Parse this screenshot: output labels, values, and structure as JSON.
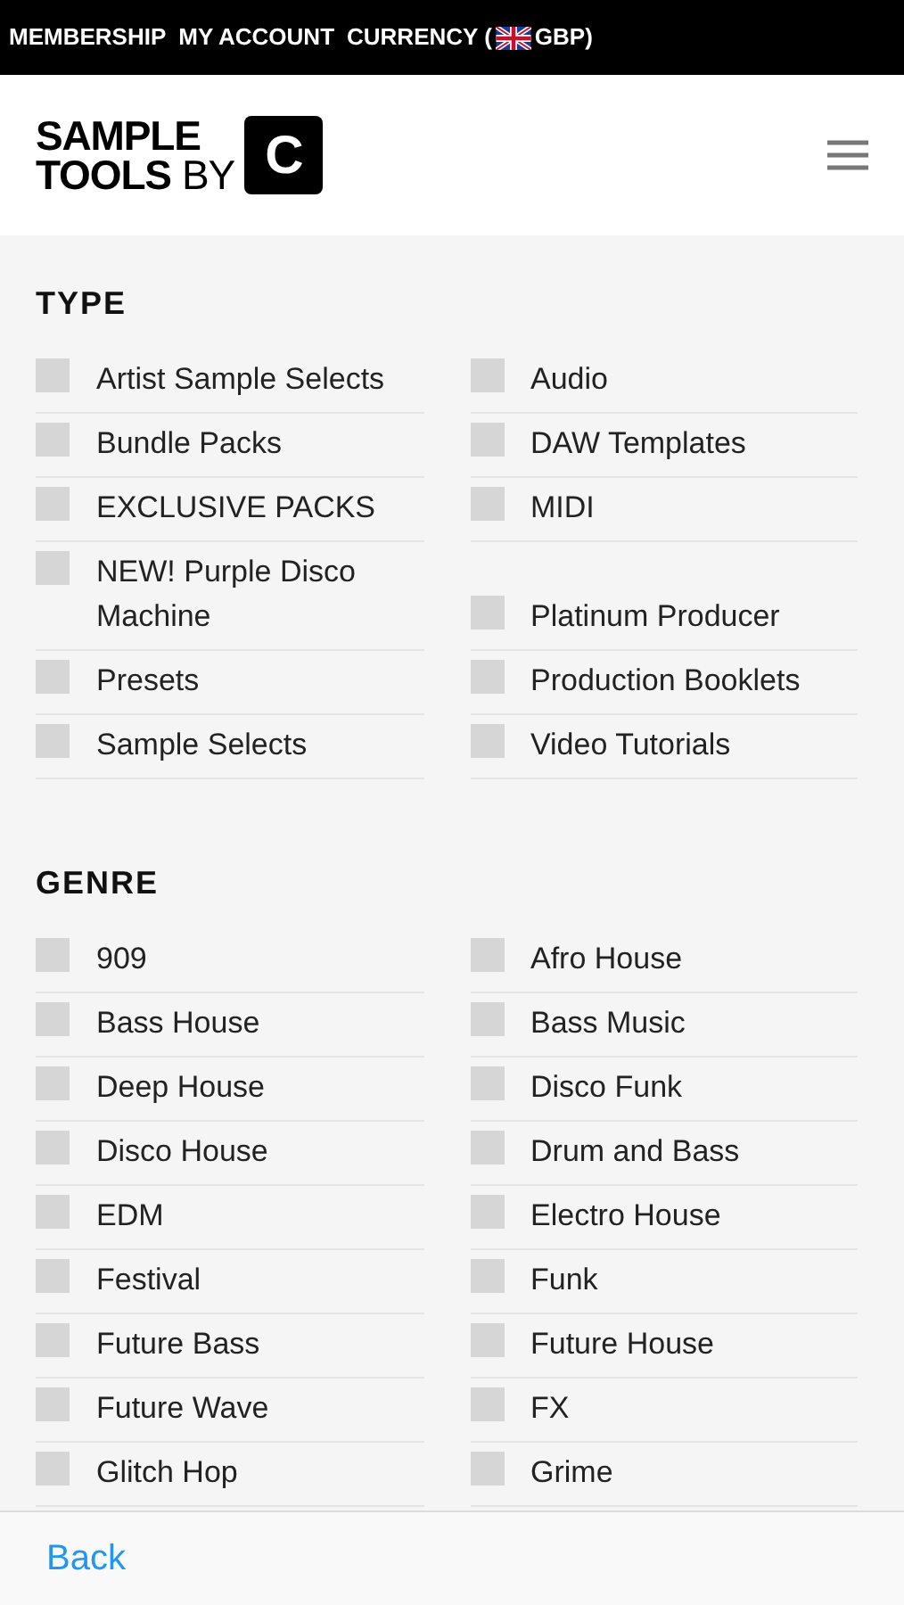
{
  "top_bar": {
    "links": [
      "MEMBERSHIP",
      "MY ACCOUNT",
      "CURRENCY (",
      "GBP)"
    ]
  },
  "header": {
    "logo_lines": [
      "SAMPLE",
      "TOOLS",
      "BY"
    ],
    "logo_mark": "C"
  },
  "sections": [
    {
      "title": "TYPE",
      "options": [
        {
          "label": "Artist Sample Selects",
          "checked": false
        },
        {
          "label": "Audio",
          "checked": false
        },
        {
          "label": "Bundle Packs",
          "checked": false
        },
        {
          "label": "DAW Templates",
          "checked": false
        },
        {
          "label": "EXCLUSIVE PACKS",
          "checked": false
        },
        {
          "label": "MIDI",
          "checked": false
        },
        {
          "label": "NEW! Purple Disco Machine",
          "checked": false
        },
        {
          "label": "Platinum Producer",
          "checked": false
        },
        {
          "label": "Presets",
          "checked": false
        },
        {
          "label": "Production Booklets",
          "checked": false
        },
        {
          "label": "Sample Selects",
          "checked": false
        },
        {
          "label": "Video Tutorials",
          "checked": false
        }
      ]
    },
    {
      "title": "GENRE",
      "options": [
        {
          "label": "909",
          "checked": false
        },
        {
          "label": "Afro House",
          "checked": false
        },
        {
          "label": "Bass House",
          "checked": false
        },
        {
          "label": "Bass Music",
          "checked": false
        },
        {
          "label": "Deep House",
          "checked": false
        },
        {
          "label": "Disco Funk",
          "checked": false
        },
        {
          "label": "Disco House",
          "checked": false
        },
        {
          "label": "Drum and Bass",
          "checked": false
        },
        {
          "label": "EDM",
          "checked": false
        },
        {
          "label": "Electro House",
          "checked": false
        },
        {
          "label": "Festival",
          "checked": false
        },
        {
          "label": "Funk",
          "checked": false
        },
        {
          "label": "Future Bass",
          "checked": false
        },
        {
          "label": "Future House",
          "checked": false
        },
        {
          "label": "Future Wave",
          "checked": false
        },
        {
          "label": "FX",
          "checked": false
        },
        {
          "label": "Glitch Hop",
          "checked": false
        },
        {
          "label": "Grime",
          "checked": false
        }
      ]
    }
  ],
  "bottom_bar": {
    "back": "Back"
  }
}
